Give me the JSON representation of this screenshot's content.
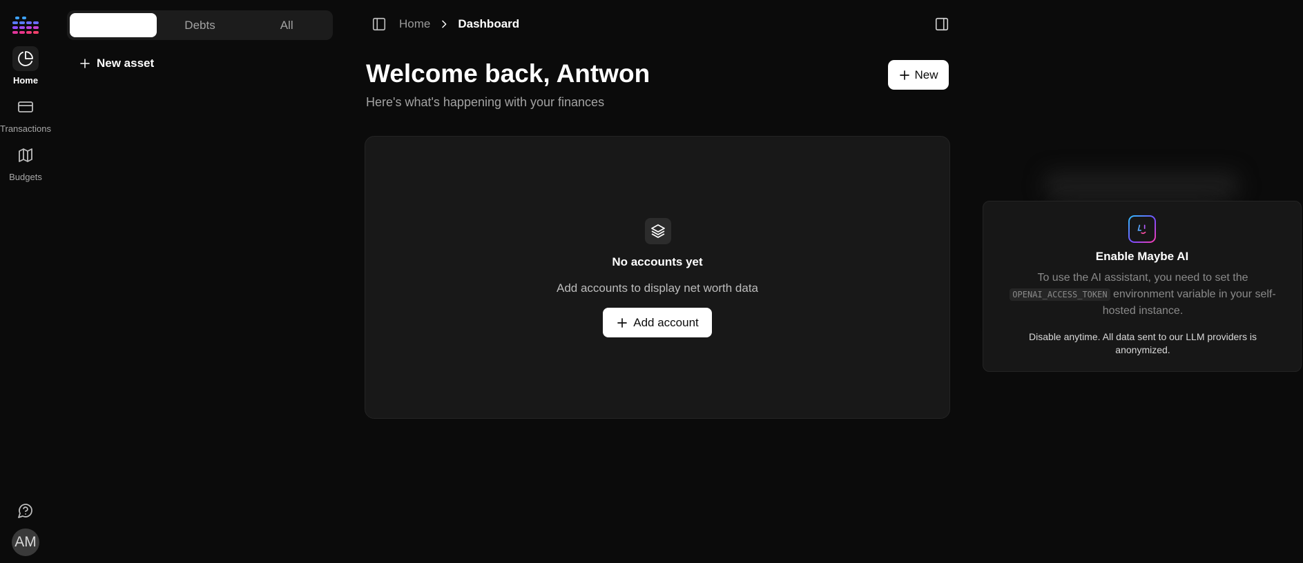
{
  "sidebar": {
    "items": [
      {
        "label": "Home",
        "icon": "pie-chart-icon",
        "active": true
      },
      {
        "label": "Transactions",
        "icon": "credit-card-icon",
        "active": false
      },
      {
        "label": "Budgets",
        "icon": "map-icon",
        "active": false
      }
    ],
    "help_icon": "help-circle-icon",
    "avatar_initials": "AM"
  },
  "accounts_panel": {
    "tabs": [
      {
        "label": "",
        "active": true
      },
      {
        "label": "Debts",
        "active": false
      },
      {
        "label": "All",
        "active": false
      }
    ],
    "new_asset_label": "New asset"
  },
  "header": {
    "breadcrumb_home": "Home",
    "breadcrumb_current": "Dashboard"
  },
  "main": {
    "title": "Welcome back, Antwon",
    "subtitle": "Here's what's happening with your finances",
    "new_button_label": "New",
    "empty_state": {
      "title": "No accounts yet",
      "subtitle": "Add accounts to display net worth data",
      "button_label": "Add account"
    }
  },
  "ai_panel": {
    "title": "Enable Maybe AI",
    "text_before": "To use the AI assistant, you need to set the",
    "env_var": "OPENAI_ACCESS_TOKEN",
    "text_after": "environment variable in your self-hosted instance.",
    "note": "Disable anytime. All data sent to our LLM providers is anonymized."
  },
  "colors": {
    "background": "#0b0b0b",
    "card": "#181818",
    "accent_logo_top": "#3a8dff",
    "accent_logo_bottom": "#e0359a"
  }
}
